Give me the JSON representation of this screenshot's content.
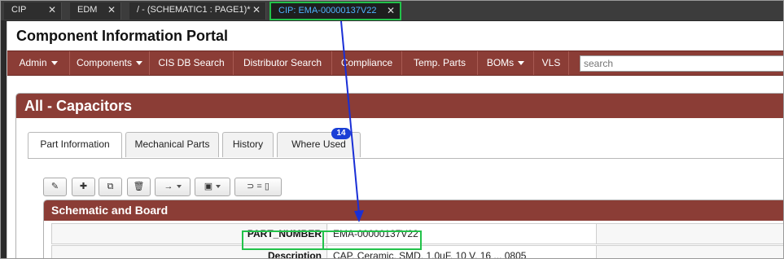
{
  "editor_tabs": [
    {
      "label": "CIP",
      "close": "✕"
    },
    {
      "label": "EDM",
      "close": "✕"
    },
    {
      "label": "/ - (SCHEMATIC1 : PAGE1)*",
      "close": "✕"
    },
    {
      "label": "CIP: EMA-00000137V22",
      "close": "✕"
    }
  ],
  "app": {
    "title": "Component Information Portal"
  },
  "nav": {
    "items": [
      "Admin",
      "Components",
      "CIS DB Search",
      "Distributor Search",
      "Compliance",
      "Temp. Parts",
      "BOMs",
      "VLS"
    ],
    "search_placeholder": "search"
  },
  "panel": {
    "title": "All - Capacitors"
  },
  "tabs": [
    "Part Information",
    "Mechanical Parts",
    "History",
    "Where Used"
  ],
  "where_used_count": "14",
  "toolbar": {
    "edit": "✎",
    "add": "✚",
    "copy": "⧉",
    "delete": "🗑",
    "move": "→",
    "save": "▣",
    "symbol": "⊃ = ▯"
  },
  "section": {
    "title": "Schematic and Board"
  },
  "fields": [
    {
      "label": "PART_NUMBER",
      "value": "EMA-00000137V22"
    },
    {
      "label": "Description",
      "value": "CAP, Ceramic, SMD, 1.0uF, 10 V, 16 ... 0805"
    }
  ],
  "colors": {
    "accent": "#8b3d36",
    "highlight": "#22c24a",
    "arrow": "#1a2fd6"
  }
}
